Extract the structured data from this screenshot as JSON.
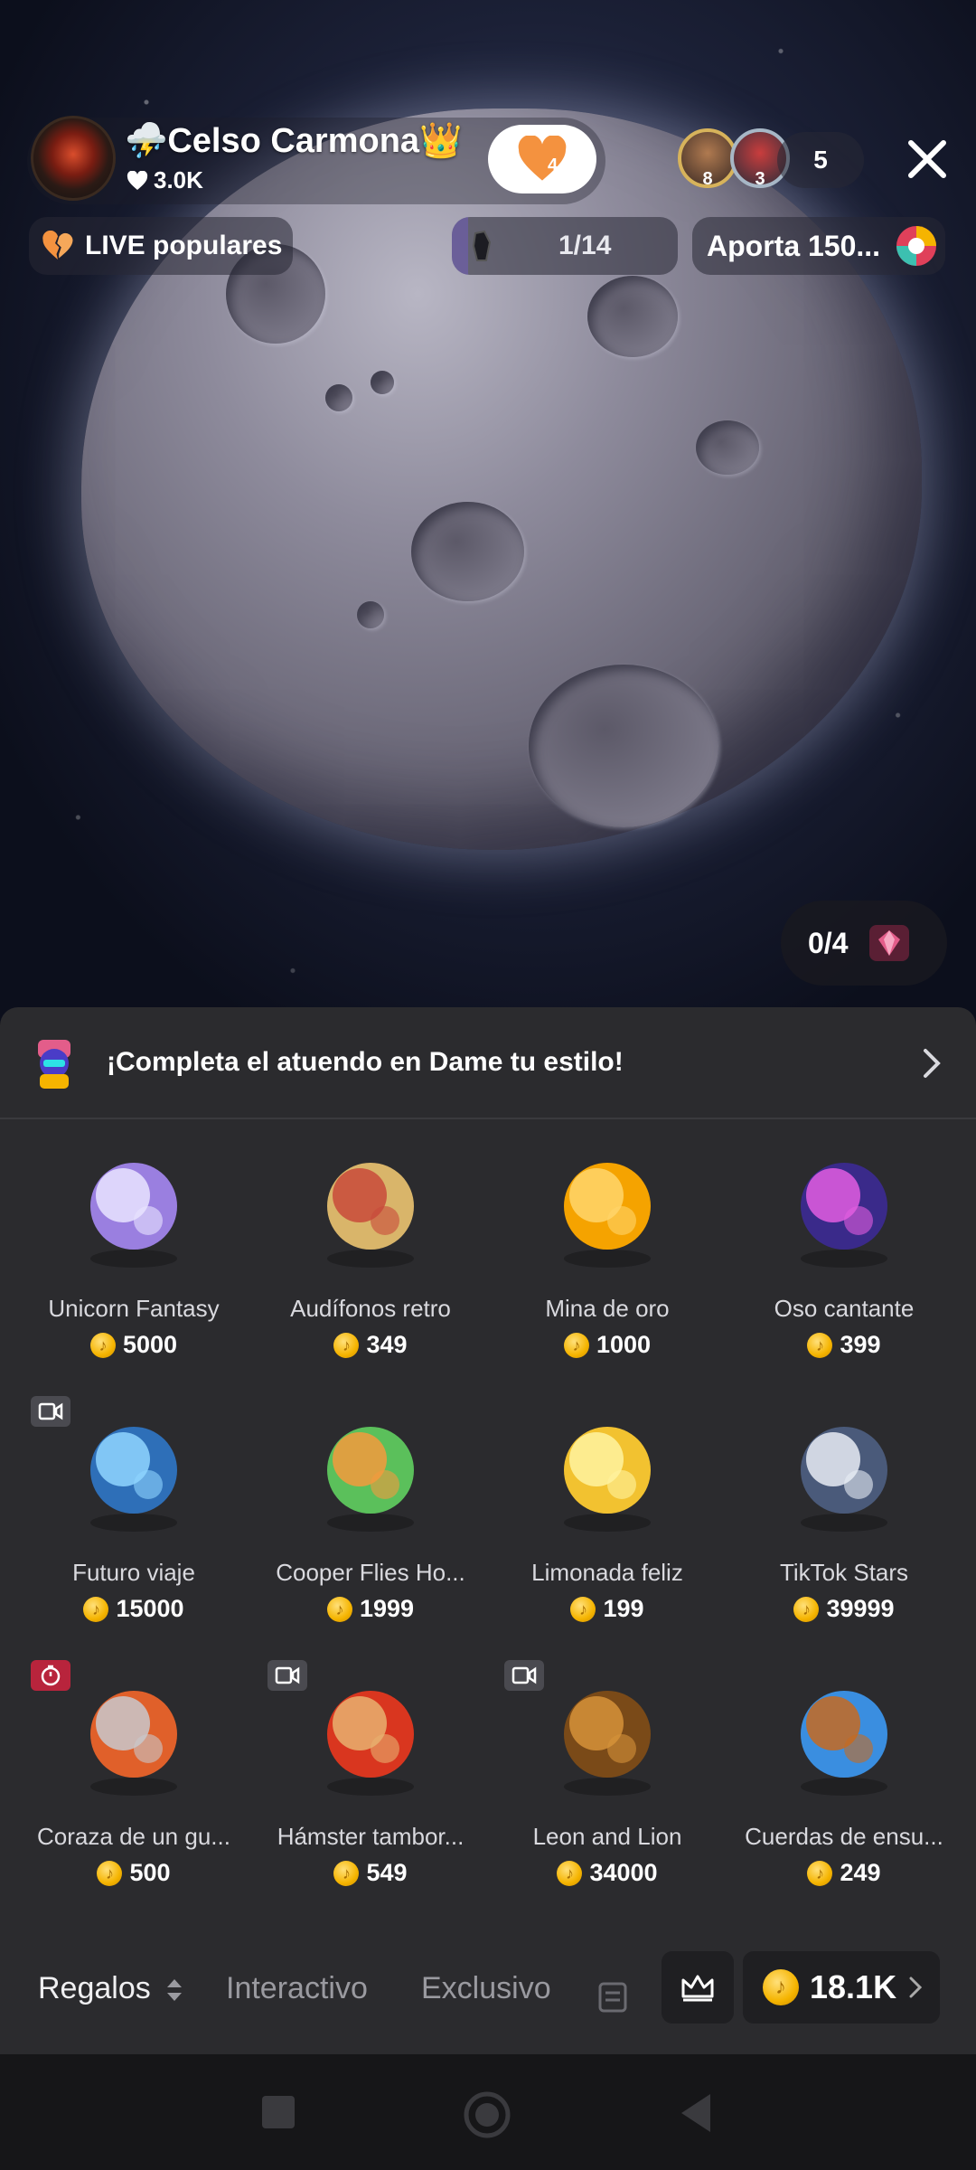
{
  "header": {
    "host_name": "⛈️Celso Carmona👑",
    "host_likes": "3.0K",
    "follow_heart_count": "4",
    "viewers": [
      {
        "rank": "8"
      },
      {
        "rank": "3"
      }
    ],
    "viewer_count": "5"
  },
  "pills": {
    "live_popular": "LIVE populares",
    "progress": "1/14",
    "progress_fraction": 0.07,
    "contribute": "Aporta 150...",
    "gem_progress": "0/4"
  },
  "promo": {
    "text": "¡Completa el atuendo en Dame tu estilo!"
  },
  "gifts": [
    {
      "name": "Unicorn Fantasy",
      "price": "5000",
      "icon": "unicorn-icon",
      "badge": ""
    },
    {
      "name": "Audífonos retro",
      "price": "349",
      "icon": "headphones-icon",
      "badge": ""
    },
    {
      "name": "Mina de oro",
      "price": "1000",
      "icon": "gold-coin-icon",
      "badge": ""
    },
    {
      "name": "Oso cantante",
      "price": "399",
      "icon": "singing-bear-icon",
      "badge": ""
    },
    {
      "name": "Futuro viaje",
      "price": "15000",
      "icon": "future-trip-icon",
      "badge": "video"
    },
    {
      "name": "Cooper Flies Ho...",
      "price": "1999",
      "icon": "corgi-balloons-icon",
      "badge": ""
    },
    {
      "name": "Limonada feliz",
      "price": "199",
      "icon": "lemonade-icon",
      "badge": ""
    },
    {
      "name": "TikTok Stars",
      "price": "39999",
      "icon": "tiktok-stars-icon",
      "badge": ""
    },
    {
      "name": "Coraza de un gu...",
      "price": "500",
      "icon": "warrior-helmet-icon",
      "badge": "timer"
    },
    {
      "name": "Hámster tambor...",
      "price": "549",
      "icon": "hamster-drum-icon",
      "badge": "video"
    },
    {
      "name": "Leon and Lion",
      "price": "34000",
      "icon": "lion-icon",
      "badge": "video"
    },
    {
      "name": "Cuerdas de ensu...",
      "price": "249",
      "icon": "violin-icon",
      "badge": ""
    }
  ],
  "tabs": {
    "gifts": "Regalos",
    "interactive": "Interactivo",
    "exclusive": "Exclusivo"
  },
  "balance": "18.1K",
  "colors": {
    "panel_bg": "#2b2b2e",
    "coin": "#f5b400",
    "badge_red": "#b8243c",
    "heart_orange": "#f4923f"
  }
}
